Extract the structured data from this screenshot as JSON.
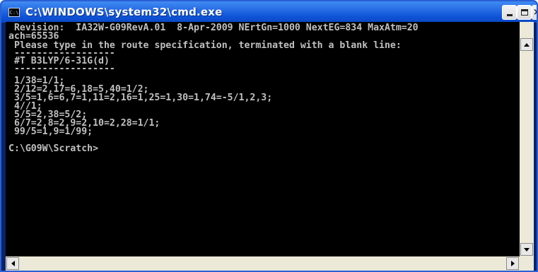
{
  "window": {
    "title": "C:\\WINDOWS\\system32\\cmd.exe",
    "icon": "cmd-icon",
    "controls": [
      "minimize-icon",
      "maximize-icon",
      "close-icon"
    ],
    "colors": {
      "titlebar": "#0f55d8",
      "console_bg": "#000000",
      "console_text": "#c0c0c0"
    }
  },
  "console": {
    "lines": [
      " Revision:  IA32W-G09RevA.01  8-Apr-2009 NErtGn=1000 NextEG=834 MaxAtm=20",
      "ach=65536",
      " Please type in the route specification, terminated with a blank line:",
      " ------------------",
      " #T B3LYP/6-31G(d)",
      " ------------------",
      " 1/38=1/1;",
      " 2/12=2,17=6,18=5,40=1/2;",
      " 3/5=1,6=6,7=1,11=2,16=1,25=1,30=1,74=-5/1,2,3;",
      " 4//1;",
      " 5/5=2,38=5/2;",
      " 6/7=2,8=2,9=2,10=2,28=1/1;",
      " 99/5=1,9=1/99;",
      "",
      "C:\\G09W\\Scratch>"
    ]
  },
  "scrollbars": {
    "vertical": [
      "scroll-up-icon",
      "scroll-down-icon"
    ],
    "horizontal": [
      "scroll-left-icon",
      "scroll-right-icon"
    ]
  }
}
